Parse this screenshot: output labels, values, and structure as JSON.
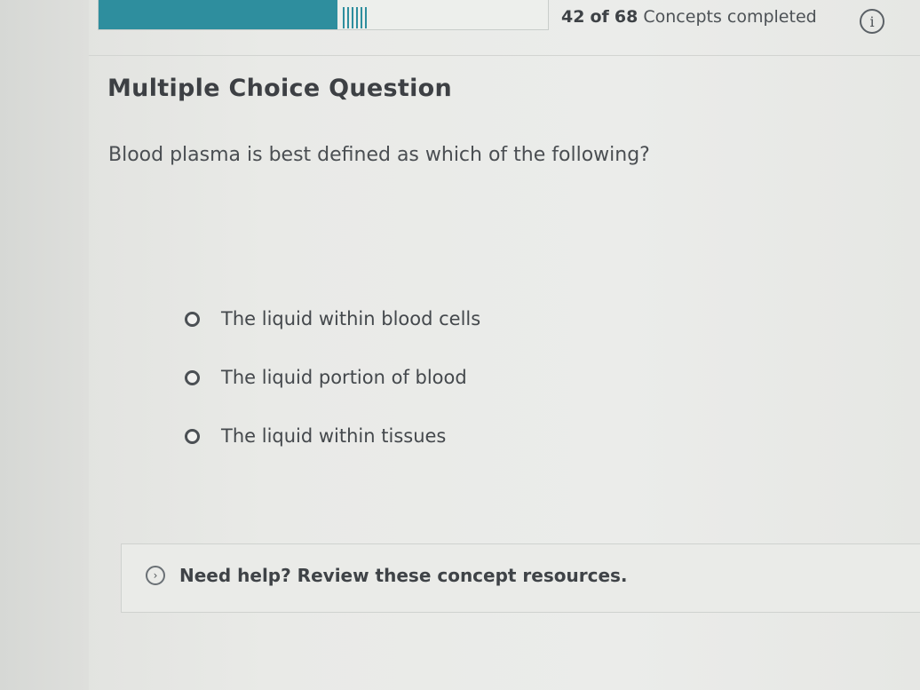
{
  "progress": {
    "completed": "42",
    "of_label": "of",
    "total": "68",
    "suffix": "Concepts completed",
    "fraction": 0.618
  },
  "question": {
    "type_label": "Multiple Choice Question",
    "prompt": "Blood plasma is best defined as which of the following?",
    "options": [
      {
        "label": "The liquid within blood cells"
      },
      {
        "label": "The liquid portion of blood"
      },
      {
        "label": "The liquid within tissues"
      }
    ]
  },
  "help": {
    "label": "Need help? Review these concept resources."
  },
  "icons": {
    "info": "info-icon",
    "help_chevron": "chevron-right-circle-icon"
  },
  "colors": {
    "progress_fill": "#2e8e9e",
    "text": "#3a3d40"
  }
}
